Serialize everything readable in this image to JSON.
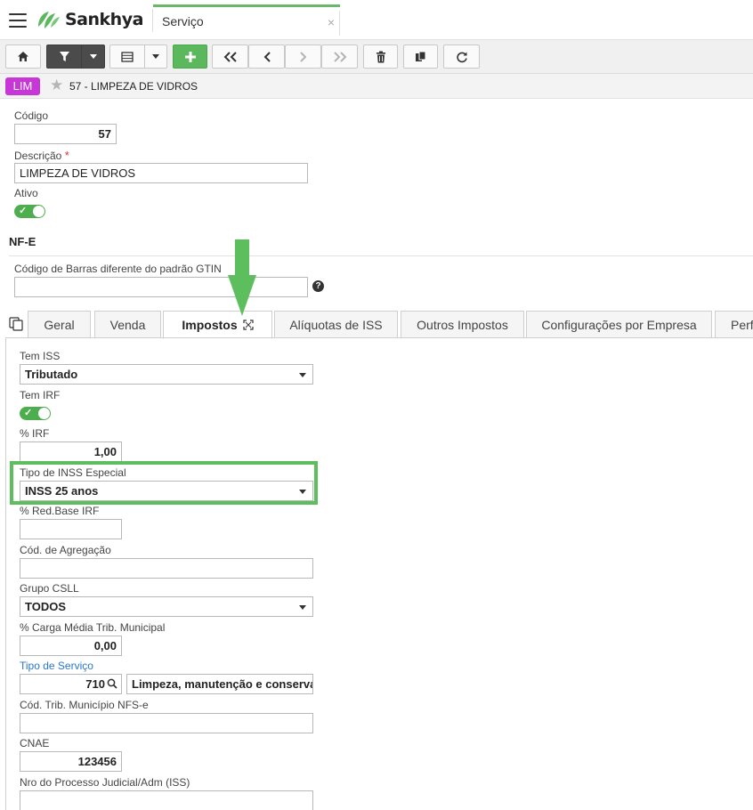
{
  "header": {
    "brand": "Sankhya",
    "page_tab": "Serviço",
    "close_symbol": "×"
  },
  "toolbar": {
    "buttons": [
      "home-icon",
      "filter-icon",
      "dropdown-icon",
      "grid-icon",
      "dropdown-icon",
      "add-icon",
      "first-record-icon",
      "previous-record-icon",
      "next-record-icon",
      "last-record-icon",
      "delete-icon",
      "duplicate-icon",
      "refresh-icon"
    ]
  },
  "record": {
    "badge": "LIM",
    "title": "57 - LIMPEZA DE VIDROS",
    "badge_color": "#c637d6"
  },
  "form": {
    "codigo_label": "Código",
    "codigo_value": "57",
    "descricao_label": "Descrição",
    "required_mark": "*",
    "descricao_value": "LIMPEZA DE VIDROS",
    "ativo_label": "Ativo"
  },
  "nfe": {
    "section_title": "NF-E",
    "gtin_label": "Código de Barras diferente do padrão GTIN",
    "gtin_value": "",
    "help_symbol": "?"
  },
  "tabs": [
    {
      "label": "Geral"
    },
    {
      "label": "Venda"
    },
    {
      "label": "Impostos"
    },
    {
      "label": "Alíquotas de ISS"
    },
    {
      "label": "Outros Impostos"
    },
    {
      "label": "Configurações por Empresa"
    },
    {
      "label": "Perf"
    }
  ],
  "impostos": {
    "tem_iss_label": "Tem ISS",
    "tem_iss_value": "Tributado",
    "tem_irf_label": "Tem IRF",
    "irf_pct_label": "% IRF",
    "irf_pct_value": "1,00",
    "tipo_inss_label": "Tipo de INSS Especial",
    "tipo_inss_value": "INSS 25 anos",
    "red_base_irf_label": "% Red.Base IRF",
    "red_base_irf_value": "",
    "cod_agregacao_label": "Cód. de Agregação",
    "cod_agregacao_value": "",
    "grupo_csll_label": "Grupo CSLL",
    "grupo_csll_value": "TODOS",
    "carga_media_label": "% Carga Média Trib. Municipal",
    "carga_media_value": "0,00",
    "tipo_servico_label": "Tipo de Serviço",
    "tipo_servico_code": "710",
    "tipo_servico_desc": "Limpeza, manutenção e conserva",
    "cod_trib_label": "Cód. Trib. Município NFS-e",
    "cod_trib_value": "",
    "cnae_label": "CNAE",
    "cnae_value": "123456",
    "nro_processo_label": "Nro do Processo Judicial/Adm (ISS)",
    "nro_processo_value": ""
  },
  "colors": {
    "accent_green": "#5cb85c",
    "highlight_green": "#5dbe5d",
    "link_blue": "#2a77c9"
  }
}
